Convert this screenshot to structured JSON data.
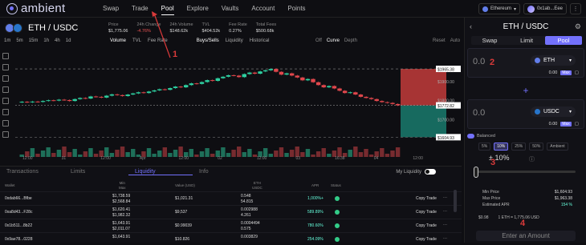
{
  "header": {
    "brand": "ambient",
    "nav": [
      "Swap",
      "Trade",
      "Pool",
      "Explore",
      "Vaults",
      "Account",
      "Points"
    ],
    "network": "Ethereum",
    "wallet": "0x1ab...Eee",
    "more": "⋮"
  },
  "pair": {
    "title": "ETH / USDC",
    "stats": [
      {
        "label": "Price",
        "value": "$1,775.06"
      },
      {
        "label": "24h Change",
        "value": "-4.76%",
        "negative": true
      },
      {
        "label": "24h Volume",
        "value": "$148.62k"
      },
      {
        "label": "TVL",
        "value": "$404.52k"
      },
      {
        "label": "Fee Rate",
        "value": "0.27%"
      },
      {
        "label": "Total Fees",
        "value": "$500.68k"
      }
    ],
    "timeframes": [
      "1m",
      "5m",
      "15m",
      "1h",
      "4h",
      "1d"
    ],
    "chart_controls": [
      "Volume",
      "TVL",
      "Fee Rate",
      "Buys/Sells",
      "Liquidity",
      "Historical"
    ],
    "curve_controls": [
      "Off",
      "Curve",
      "Depth"
    ],
    "reset_controls": [
      "Reset",
      "Auto"
    ]
  },
  "chart_data": {
    "type": "candlestick",
    "ylim": [
      1560,
      2050
    ],
    "y_ticks": [
      "$1965.38",
      "$1900.00",
      "$1800.00",
      "$1772.82",
      "$1700.00",
      "$1604.93"
    ],
    "x_ticks": [
      "12:00",
      "31",
      "12:00",
      "Apr",
      "12:00",
      "02",
      "12:00",
      "03",
      "16:38",
      "04",
      "12:00"
    ],
    "y_tick_values": [
      1965.38,
      1900,
      1800,
      1772.82,
      1700,
      1604.93
    ],
    "candles": [
      1792,
      1789,
      1793,
      1791,
      1796,
      1800,
      1798,
      1803,
      1801,
      1796,
      1806,
      1812,
      1809,
      1820,
      1818,
      1814,
      1824,
      1831,
      1827,
      1822,
      1830,
      1836,
      1842,
      1838,
      1846,
      1852,
      1858,
      1855,
      1864,
      1872,
      1868,
      1880,
      1889,
      1886,
      1896,
      1906,
      1902,
      1916,
      1924,
      1932,
      1930,
      1922,
      1938,
      1946,
      1940,
      1952,
      1958,
      1965,
      1950,
      1935,
      1942,
      1930,
      1920,
      1905,
      1912,
      1895,
      1880,
      1868,
      1875,
      1862,
      1850,
      1838,
      1842,
      1830,
      1818,
      1812,
      1806,
      1796,
      1790,
      1786,
      1780,
      1773
    ]
  },
  "bottom": {
    "tabs": [
      "Transactions",
      "Limits",
      "Liquidity",
      "Info"
    ],
    "my_liquidity": "My Liquidity",
    "headers": [
      "Wallet",
      "Min\nMax",
      "Value (USD)",
      "ETH\nUSDC",
      "APR",
      "Status"
    ],
    "rows": [
      {
        "wallet": "0xdab66...Bfbe",
        "min": "$1,738.59",
        "max": "$2,568.84",
        "value": "$1,021.31",
        "eth": "0.548",
        "usdc": "54.815",
        "apr": "1,000%+",
        "action": "Copy Trade"
      },
      {
        "wallet": "0xa8d43...F28c",
        "min": "$1,620.41",
        "max": "$1,982.32",
        "value": "$9,537",
        "eth": "0.002988",
        "usdc": "4.261",
        "apr": "589.89%",
        "action": "Copy Trade"
      },
      {
        "wallet": "0x1b511...8b22",
        "min": "$1,643.91",
        "max": "$2,011.07",
        "value": "$0.99039",
        "eth": "0.0004494",
        "usdc": "0.575",
        "apr": "780.60%",
        "action": "Copy Trade"
      },
      {
        "wallet": "0x9ae78...0228",
        "min": "$1,643.91",
        "max": "",
        "value": "$10.826",
        "eth": "0.003829",
        "usdc": "",
        "apr": "254.09%",
        "action": "Copy Trade"
      }
    ]
  },
  "panel": {
    "title": "ETH / USDC",
    "tabs": [
      "Swap",
      "Limit",
      "Pool"
    ],
    "token_a": {
      "amount": "0.0",
      "symbol": "ETH",
      "balance": "0.00",
      "max": "Max"
    },
    "token_b": {
      "amount": "0.0",
      "symbol": "USDC",
      "balance": "0.00",
      "max": "Max"
    },
    "plus": "+",
    "balanced": "Balanced",
    "pcts": [
      "5%",
      "10%",
      "25%",
      "50%",
      "Ambient"
    ],
    "range": "± 10%",
    "min_price_label": "Min Price",
    "min_price": "$1,604.93",
    "max_price_label": "Max Price",
    "max_price": "$1,963.38",
    "apr_label": "Estimated APR",
    "apr": "154 %",
    "gas": "$0.98",
    "rate": "1 ETH = 1,775.06 USD",
    "enter": "Enter an Amount"
  },
  "annotations": [
    "1",
    "2",
    "3",
    "4"
  ]
}
